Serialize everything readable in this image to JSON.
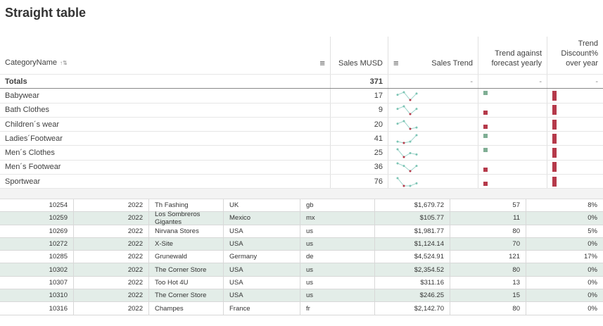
{
  "title": "Straight table",
  "table": {
    "headers": {
      "category": "CategoryName",
      "sales": "Sales MUSD",
      "trend": "Sales Trend",
      "forecast": "Trend against forecast yearly",
      "discount": "Trend Discount% over year"
    },
    "totals": {
      "label": "Totals",
      "sales": "371",
      "trend": "-",
      "forecast": "-",
      "discount": "-"
    },
    "rows": [
      {
        "category": "Babywear",
        "sales": "17",
        "spark": [
          3,
          4,
          1,
          3.5
        ],
        "forecast": "up"
      },
      {
        "category": "Bath Clothes",
        "sales": "9",
        "spark": [
          3,
          4,
          1,
          3
        ],
        "forecast": "down"
      },
      {
        "category": "Children´s wear",
        "sales": "20",
        "spark": [
          3,
          4,
          1,
          1.5
        ],
        "forecast": "down"
      },
      {
        "category": "Ladies´Footwear",
        "sales": "41",
        "spark": [
          1.5,
          1,
          1.5,
          4
        ],
        "forecast": "up"
      },
      {
        "category": "Men´s Clothes",
        "sales": "25",
        "spark": [
          4,
          1,
          2.5,
          2
        ],
        "forecast": "up"
      },
      {
        "category": "Men´s Footwear",
        "sales": "36",
        "spark": [
          4,
          3,
          1,
          3
        ],
        "forecast": "down"
      },
      {
        "category": "Sportwear",
        "sales": "76",
        "spark": [
          4,
          1,
          1,
          2
        ],
        "forecast": "down"
      }
    ]
  },
  "colors": {
    "up": "#7fae94",
    "down": "#b5394a",
    "line": "#9fd6cc"
  },
  "orders": [
    [
      "10254",
      "2022",
      "Th Fashing",
      "UK",
      "gb",
      "$1,679.72",
      "57",
      "8%"
    ],
    [
      "10259",
      "2022",
      "Los Sombreros Gigantes",
      "Mexico",
      "mx",
      "$105.77",
      "11",
      "0%"
    ],
    [
      "10269",
      "2022",
      "Nirvana Stores",
      "USA",
      "us",
      "$1,981.77",
      "80",
      "5%"
    ],
    [
      "10272",
      "2022",
      "X-Site",
      "USA",
      "us",
      "$1,124.14",
      "70",
      "0%"
    ],
    [
      "10285",
      "2022",
      "Grunewald",
      "Germany",
      "de",
      "$4,524.91",
      "121",
      "17%"
    ],
    [
      "10302",
      "2022",
      "The Corner Store",
      "USA",
      "us",
      "$2,354.52",
      "80",
      "0%"
    ],
    [
      "10307",
      "2022",
      "Too Hot 4U",
      "USA",
      "us",
      "$311.16",
      "13",
      "0%"
    ],
    [
      "10310",
      "2022",
      "The Corner Store",
      "USA",
      "us",
      "$246.25",
      "15",
      "0%"
    ],
    [
      "10316",
      "2022",
      "Champes",
      "France",
      "fr",
      "$2,142.70",
      "80",
      "0%"
    ]
  ]
}
